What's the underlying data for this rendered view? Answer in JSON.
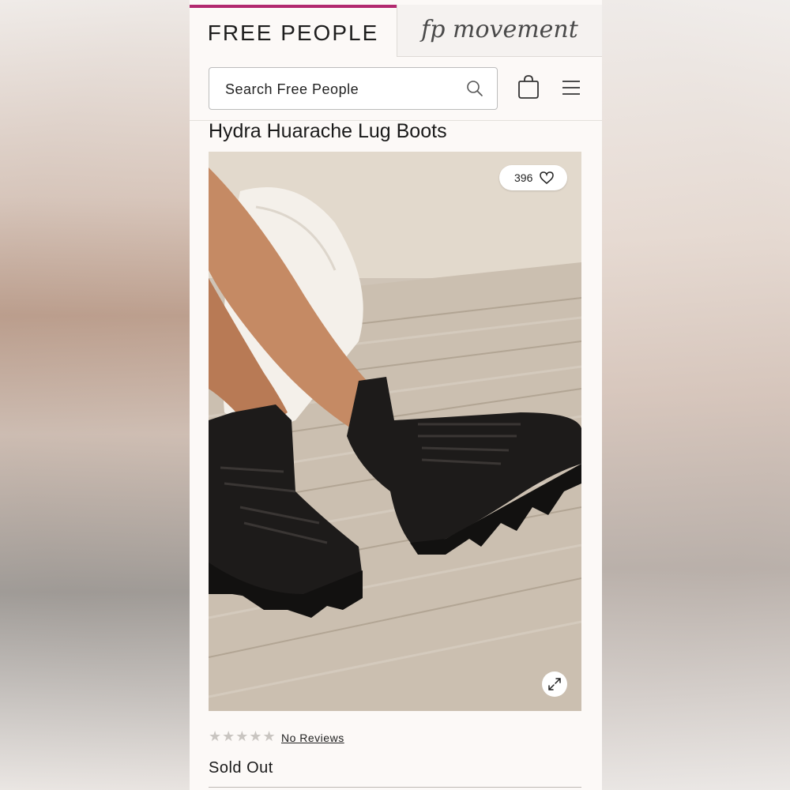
{
  "brand_tabs": {
    "primary": "FREE PEOPLE",
    "secondary": "fp movement"
  },
  "search": {
    "placeholder": "Search Free People",
    "icon": "search-icon"
  },
  "header_icons": [
    "bag-icon",
    "menu-icon"
  ],
  "product": {
    "title": "Hydra Huarache Lug Boots",
    "likes": "396",
    "rating_stars": "★★★★★",
    "reviews_label": "No Reviews",
    "status": "Sold Out"
  },
  "colors": {
    "accent": "#b2296f",
    "text": "#1a1a1a",
    "background": "#fcf9f7"
  }
}
